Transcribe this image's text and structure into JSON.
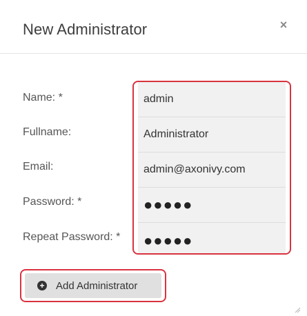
{
  "dialog": {
    "title": "New Administrator",
    "close_glyph": "×"
  },
  "form": {
    "name_label": "Name: *",
    "fullname_label": "Fullname:",
    "email_label": "Email:",
    "password_label": "Password: *",
    "repeat_password_label": "Repeat Password: *",
    "name_value": "admin",
    "fullname_value": "Administrator",
    "email_value": "admin@axonivy.com",
    "password_value": "●●●●●",
    "repeat_password_value": "●●●●●"
  },
  "actions": {
    "add_label": "Add Administrator",
    "add_icon": "plus-circle-icon"
  },
  "colors": {
    "highlight": "#d9323f",
    "input_bg": "#f1f1f1",
    "button_bg": "#e0e0e0"
  }
}
